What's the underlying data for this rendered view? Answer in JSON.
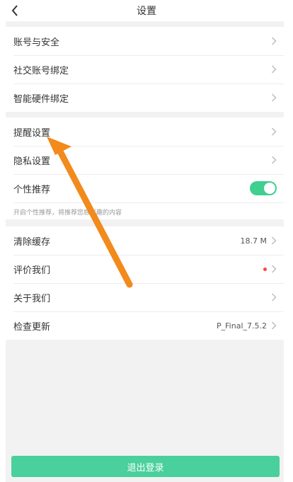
{
  "header": {
    "title": "设置",
    "back_icon": "chevron-left-icon"
  },
  "group1": {
    "items": [
      {
        "label": "账号与安全"
      },
      {
        "label": "社交账号绑定"
      },
      {
        "label": "智能硬件绑定"
      }
    ]
  },
  "group2": {
    "items": [
      {
        "label": "提醒设置"
      },
      {
        "label": "隐私设置"
      },
      {
        "label": "个性推荐",
        "toggle_on": true
      }
    ],
    "hint": "开启个性推荐，将推荐您感兴趣的内容"
  },
  "group3": {
    "items": [
      {
        "label": "清除缓存",
        "value": "18.7 M"
      },
      {
        "label": "评价我们",
        "badge": "red-dot"
      },
      {
        "label": "关于我们"
      },
      {
        "label": "检查更新",
        "value": "P_Final_7.5.2"
      }
    ]
  },
  "logout": {
    "label": "退出登录"
  },
  "colors": {
    "accent": "#49d09c",
    "toggle": "#3fcf8e",
    "badge": "#ff4444",
    "annotation_arrow": "#f28a1c"
  }
}
